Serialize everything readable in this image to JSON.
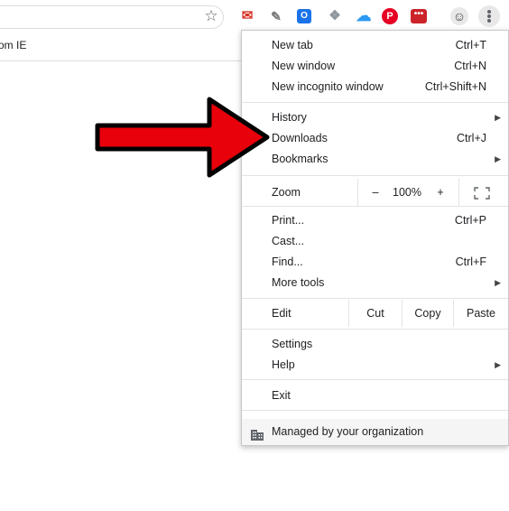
{
  "bookmarks_bar": {
    "partial_text": "om IE"
  },
  "toolbar": {
    "bookmark_star_icon": "star-outline-icon",
    "extensions": [
      {
        "name": "gmail-extension-icon",
        "glyph": "M",
        "color": "#d93025"
      },
      {
        "name": "eraser-extension-icon",
        "glyph": "◇",
        "color": "#8a8a8a"
      },
      {
        "name": "outlook-extension-icon",
        "glyph": "O",
        "color": "#1a73e8"
      },
      {
        "name": "dropbox-extension-icon",
        "glyph": "❖",
        "color": "#9aa0a6"
      },
      {
        "name": "onedrive-extension-icon",
        "glyph": "☁",
        "color": "#2b9af3"
      },
      {
        "name": "pinterest-extension-icon",
        "glyph": "P",
        "color": "#e60023"
      },
      {
        "name": "lastpass-extension-icon",
        "glyph": "•••",
        "color": "#cc2229"
      },
      {
        "name": "profile-avatar-icon",
        "glyph": "☺",
        "color": "#5f6368"
      }
    ],
    "menu_button_icon": "three-dot-vertical-icon"
  },
  "menu": {
    "new_tab": {
      "label": "New tab",
      "shortcut": "Ctrl+T"
    },
    "new_window": {
      "label": "New window",
      "shortcut": "Ctrl+N"
    },
    "new_incognito": {
      "label": "New incognito window",
      "shortcut": "Ctrl+Shift+N"
    },
    "history": {
      "label": "History"
    },
    "downloads": {
      "label": "Downloads",
      "shortcut": "Ctrl+J"
    },
    "bookmarks": {
      "label": "Bookmarks"
    },
    "zoom": {
      "label": "Zoom",
      "minus": "–",
      "value": "100%",
      "plus": "+"
    },
    "print": {
      "label": "Print...",
      "shortcut": "Ctrl+P"
    },
    "cast": {
      "label": "Cast..."
    },
    "find": {
      "label": "Find...",
      "shortcut": "Ctrl+F"
    },
    "more_tools": {
      "label": "More tools"
    },
    "edit": {
      "label": "Edit",
      "cut": "Cut",
      "copy": "Copy",
      "paste": "Paste"
    },
    "settings": {
      "label": "Settings"
    },
    "help": {
      "label": "Help"
    },
    "exit": {
      "label": "Exit"
    },
    "managed": {
      "label": "Managed by your organization"
    }
  },
  "annotation": {
    "arrow_color": "#e8000b",
    "arrow_outline": "#000000"
  }
}
